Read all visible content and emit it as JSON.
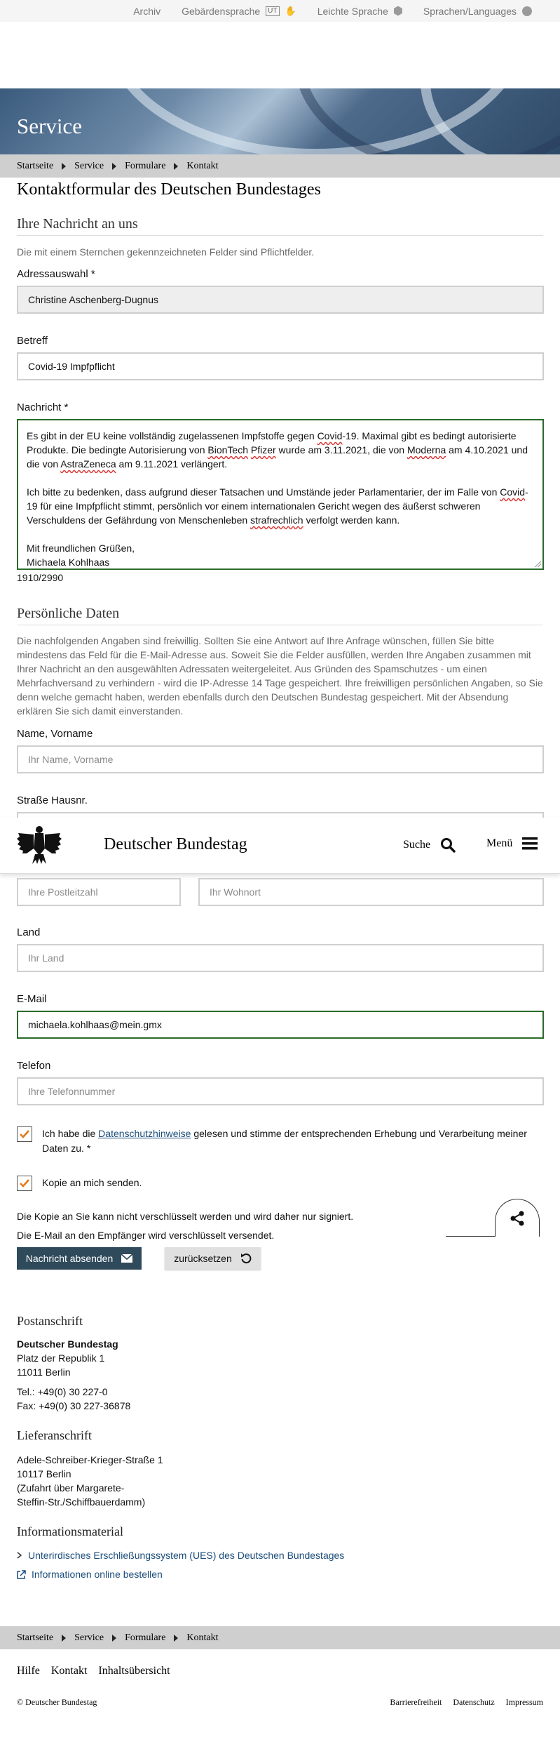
{
  "topbar": {
    "archive": "Archiv",
    "sign_language": "Gebärdensprache",
    "sign_badge": "UT",
    "easy_language": "Leichte Sprache",
    "languages": "Sprachen/Languages"
  },
  "hero": {
    "title": "Service"
  },
  "breadcrumb": [
    "Startseite",
    "Service",
    "Formulare",
    "Kontakt"
  ],
  "page": {
    "title": "Kontaktformular des Deutschen Bundestages",
    "message_section": "Ihre Nachricht an uns",
    "required_note": "Die mit einem Sternchen gekennzeichneten Felder sind Pflichtfelder."
  },
  "form": {
    "address_label": "Adressauswahl *",
    "address_value": "Christine Aschenberg-Dugnus",
    "subject_label": "Betreff",
    "subject_value": "Covid-19 Impfpflicht",
    "message_label": "Nachricht *",
    "message_p1_a": "Es gibt in der EU keine vollständig zugelassenen Impfstoffe gegen ",
    "message_p1_w1": "Covid",
    "message_p1_b": "-19. Maximal gibt es bedingt autorisierte Produkte. Die bedingte Autorisierung von ",
    "message_p1_w2": "BionTech",
    "message_p1_w3": "Pfizer",
    "message_p1_c": " wurde am 3.11.2021, die von ",
    "message_p1_w4": "Moderna",
    "message_p1_d": " am 4.10.2021 und die von ",
    "message_p1_w5": "AstraZeneca",
    "message_p1_e": " am 9.11.2021 verlängert.",
    "message_p2_a": "Ich bitte zu bedenken, dass aufgrund dieser Tatsachen und Umstände jeder Parlamentarier, der im Falle von ",
    "message_p2_w1": "Covid",
    "message_p2_b": "-19 für eine Impfpflicht stimmt, persönlich vor einem internationalen Gericht wegen des äußerst schweren Verschuldens der Gefährdung von Menschenleben ",
    "message_p2_w2": "strafrechlich",
    "message_p2_c": " verfolgt werden kann.",
    "message_greeting": "Mit freundlichen Grüßen,",
    "message_name": "Michaela Kohlhaas",
    "char_count": "1910/2990",
    "personal_section": "Persönliche Daten",
    "personal_note": "Die nachfolgenden Angaben sind freiwillig. Sollten Sie eine Antwort auf Ihre Anfrage wünschen, füllen Sie bitte mindestens das Feld für die E-Mail-Adresse aus. Soweit Sie die Felder ausfüllen, werden Ihre Angaben zusammen mit Ihrer Nachricht an den ausgewählten Adressaten weitergeleitet. Aus Gründen des Spamschutzes - um einen Mehrfachversand zu verhindern - wird die IP-Adresse 14 Tage gespeichert. Ihre freiwilligen persönlichen Angaben, so Sie denn welche gemacht haben, werden ebenfalls durch den Deutschen Bundestag gespeichert. Mit der Absendung erklären Sie sich damit einverstanden.",
    "name_label": "Name, Vorname",
    "name_placeholder": "Ihr Name, Vorname",
    "street_label": "Straße Hausnr.",
    "zip_placeholder": "Ihre Postleitzahl",
    "city_placeholder": "Ihr Wohnort",
    "country_label": "Land",
    "country_placeholder": "Ihr Land",
    "email_label": "E-Mail",
    "email_value": "michaela.kohlhaas@mein.gmx",
    "phone_label": "Telefon",
    "phone_placeholder": "Ihre Telefonnummer",
    "privacy_pre": "Ich habe die ",
    "privacy_link": "Datenschutzhinweise",
    "privacy_post": " gelesen und stimme der entsprechenden Erhebung und Verarbeitung meiner Daten zu. *",
    "copy_label": "Kopie an mich senden.",
    "sign_note": "Die Kopie an Sie kann nicht verschlüsselt werden und wird daher nur signiert.",
    "encrypt_note": "Die E-Mail an den Empfänger wird verschlüsselt versendet.",
    "submit": "Nachricht absenden",
    "reset": "zurücksetzen"
  },
  "sticky_header": {
    "brand": "Deutscher Bundestag",
    "search": "Suche",
    "menu": "Menü"
  },
  "footer": {
    "postal_heading": "Postanschrift",
    "postal_name": "Deutscher Bundestag",
    "postal_street": "Platz der Republik 1",
    "postal_city": "11011 Berlin",
    "phone": "Tel.: +49(0) 30 227-0",
    "fax": "Fax: +49(0) 30 227-36878",
    "delivery_heading": "Lieferanschrift",
    "delivery_street": "Adele-Schreiber-Krieger-Straße 1",
    "delivery_city": "10117 Berlin",
    "delivery_note1": "(Zufahrt über Margarete-",
    "delivery_note2": "Steffin-Str./Schiffbauerdamm)",
    "info_heading": "Informationsmaterial",
    "info_link1": "Unterirdisches Erschließungssystem (UES) des Deutschen Bundestages",
    "info_link2": "Informationen online bestellen",
    "links": [
      "Hilfe",
      "Kontakt",
      "Inhaltsübersicht"
    ],
    "copyright": "© Deutscher Bundestag",
    "legal": [
      "Barrierefreiheit",
      "Datenschutz",
      "Impressum"
    ]
  },
  "colors": {
    "accent_green": "#2b6b2b",
    "button_dark": "#2f4a5b",
    "link": "#1a4c7a",
    "check_orange": "#e07b1a"
  }
}
